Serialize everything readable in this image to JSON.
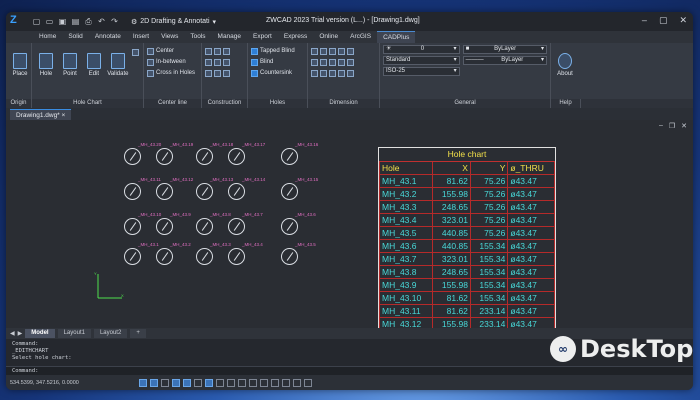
{
  "window": {
    "title": "ZWCAD 2023 Trial version (L...) - [Drawing1.dwg]",
    "workspace": "2D Drafting & Annotati"
  },
  "ribbon_tabs": [
    "Home",
    "Solid",
    "Annotate",
    "Insert",
    "Views",
    "Tools",
    "Manage",
    "Export",
    "Express",
    "Online",
    "ArcGIS",
    "CADPlus"
  ],
  "active_tab": "CADPlus",
  "ribbon": {
    "origin": {
      "label": "Origin",
      "place": "Place"
    },
    "hole_chart": {
      "label": "Hole Chart",
      "buttons": [
        "Hole",
        "Point",
        "Edit",
        "Validate"
      ]
    },
    "center_line": {
      "label": "Center line",
      "items": [
        "Center",
        "In-between",
        "Cross in Holes"
      ]
    },
    "construction": {
      "label": "Construction"
    },
    "holes": {
      "label": "Holes",
      "items": [
        "Tapped Blind",
        "Blind",
        "Countersink"
      ]
    },
    "dimension": {
      "label": "Dimension"
    },
    "general": {
      "label": "General",
      "layer": "0",
      "color": "ByLayer",
      "linetype": "ByLayer",
      "style": "Standard",
      "iso": "ISO-25"
    },
    "help": {
      "label": "Help",
      "about": "About"
    }
  },
  "doc_tab": "Drawing1.dwg*",
  "holes": [
    [
      "_MH_43.20",
      "_MH_43.19",
      "_MH_43.18",
      "_MH_43.17",
      "_MH_43.16"
    ],
    [
      "_MH_43.11",
      "_MH_43.12",
      "_MH_43.13",
      "_MH_43.14",
      "_MH_43.15"
    ],
    [
      "_MH_43.10",
      "_MH_43.9",
      "_MH_43.8",
      "_MH_43.7",
      "_MH_43.6"
    ],
    [
      "_MH_43.1",
      "_MH_43.2",
      "_MH_43.3",
      "_MH_43.4",
      "_MH_43.5"
    ]
  ],
  "hole_chart": {
    "title": "Hole chart",
    "headers": [
      "Hole",
      "X",
      "Y",
      "ø_THRU"
    ],
    "rows": [
      [
        "MH_43.1",
        "81.62",
        "75.26",
        "ø43.47"
      ],
      [
        "MH_43.2",
        "155.98",
        "75.26",
        "ø43.47"
      ],
      [
        "MH_43.3",
        "248.65",
        "75.26",
        "ø43.47"
      ],
      [
        "MH_43.4",
        "323.01",
        "75.26",
        "ø43.47"
      ],
      [
        "MH_43.5",
        "440.85",
        "75.26",
        "ø43.47"
      ],
      [
        "MH_43.6",
        "440.85",
        "155.34",
        "ø43.47"
      ],
      [
        "MH_43.7",
        "323.01",
        "155.34",
        "ø43.47"
      ],
      [
        "MH_43.8",
        "248.65",
        "155.34",
        "ø43.47"
      ],
      [
        "MH_43.9",
        "155.98",
        "155.34",
        "ø43.47"
      ],
      [
        "MH_43.10",
        "81.62",
        "155.34",
        "ø43.47"
      ],
      [
        "MH_43.11",
        "81.62",
        "233.14",
        "ø43.47"
      ],
      [
        "MH_43.12",
        "155.98",
        "233.14",
        "ø43.47"
      ]
    ]
  },
  "layout_tabs": [
    "Model",
    "Layout1",
    "Layout2",
    "+"
  ],
  "command_history": [
    "Command:",
    "_EDITHCHART",
    "Select hole chart:"
  ],
  "command_prompt": "Command:",
  "coordinates": "534.5399, 347.5216, 0.0000",
  "watermark": "DeskTop"
}
